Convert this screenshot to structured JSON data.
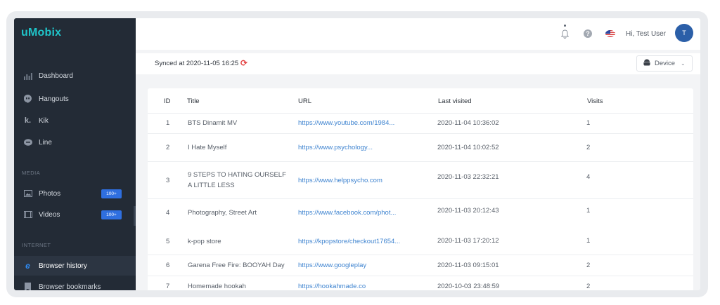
{
  "app": {
    "logo": "uMobix"
  },
  "sidebar": {
    "items": [
      {
        "label": "Dashboard",
        "icon": "dashboard-icon"
      },
      {
        "label": "Hangouts",
        "icon": "hangouts-icon"
      },
      {
        "label": "Kik",
        "icon": "kik-icon"
      },
      {
        "label": "Line",
        "icon": "line-icon"
      }
    ],
    "media_section": "MEDIA",
    "media_items": [
      {
        "label": "Photos",
        "badge": "100+",
        "icon": "photos-icon"
      },
      {
        "label": "Videos",
        "badge": "100+",
        "icon": "videos-icon"
      }
    ],
    "internet_section": "INTERNET",
    "internet_items": [
      {
        "label": "Browser history",
        "icon": "browser-history-icon",
        "active": true
      },
      {
        "label": "Browser bookmarks",
        "icon": "bookmark-icon"
      }
    ]
  },
  "header": {
    "greeting": "Hi, Test User",
    "avatar_initial": "T"
  },
  "sync": {
    "text": "Synced at 2020-11-05 16:25",
    "device_label": "Device"
  },
  "colors": {
    "sidebar_bg": "#232b36",
    "accent": "#2f6fe0",
    "link": "#3f84d0",
    "sync_icon": "#e23c3c",
    "logo": "#1fc4c9"
  },
  "table": {
    "columns": [
      "ID",
      "Title",
      "URL",
      "Last visited",
      "Visits"
    ],
    "rows": [
      {
        "id": "1",
        "title": "BTS Dinamit MV",
        "title2": "",
        "url": "https://www.youtube.com/1984...",
        "last_visited": "2020-11-04 10:36:02",
        "visits": "1"
      },
      {
        "id": "2",
        "title": "I Hate Myself",
        "title2": "",
        "url": "https://www.psychology...",
        "last_visited": "2020-11-04 10:02:52",
        "visits": "2"
      },
      {
        "id": "3",
        "title": "9 STEPS TO HATING OURSELF",
        "title2": "A LITTLE LESS",
        "url": "https://www.helppsycho.com",
        "last_visited": "2020-11-03 22:32:21",
        "visits": "4"
      },
      {
        "id": "4",
        "title": "Photography, Street Art",
        "title2": "",
        "url": "https://www.facebook.com/phot...",
        "last_visited": "2020-11-03 20:12:43",
        "visits": "1"
      },
      {
        "id": "5",
        "title": "k-pop store",
        "title2": "",
        "url": "https://kpopstore/checkout17654...",
        "last_visited": "2020-11-03 17:20:12",
        "visits": "1"
      },
      {
        "id": "6",
        "title": "Garena Free Fire: BOOYAH Day",
        "title2": "",
        "url": "https://www.googleplay",
        "last_visited": "2020-11-03 09:15:01",
        "visits": "2"
      },
      {
        "id": "7",
        "title": "Homemade hookah",
        "title2": "",
        "url": "https://hookahmade.co",
        "last_visited": "2020-10-03 23:48:59",
        "visits": "2"
      }
    ]
  }
}
